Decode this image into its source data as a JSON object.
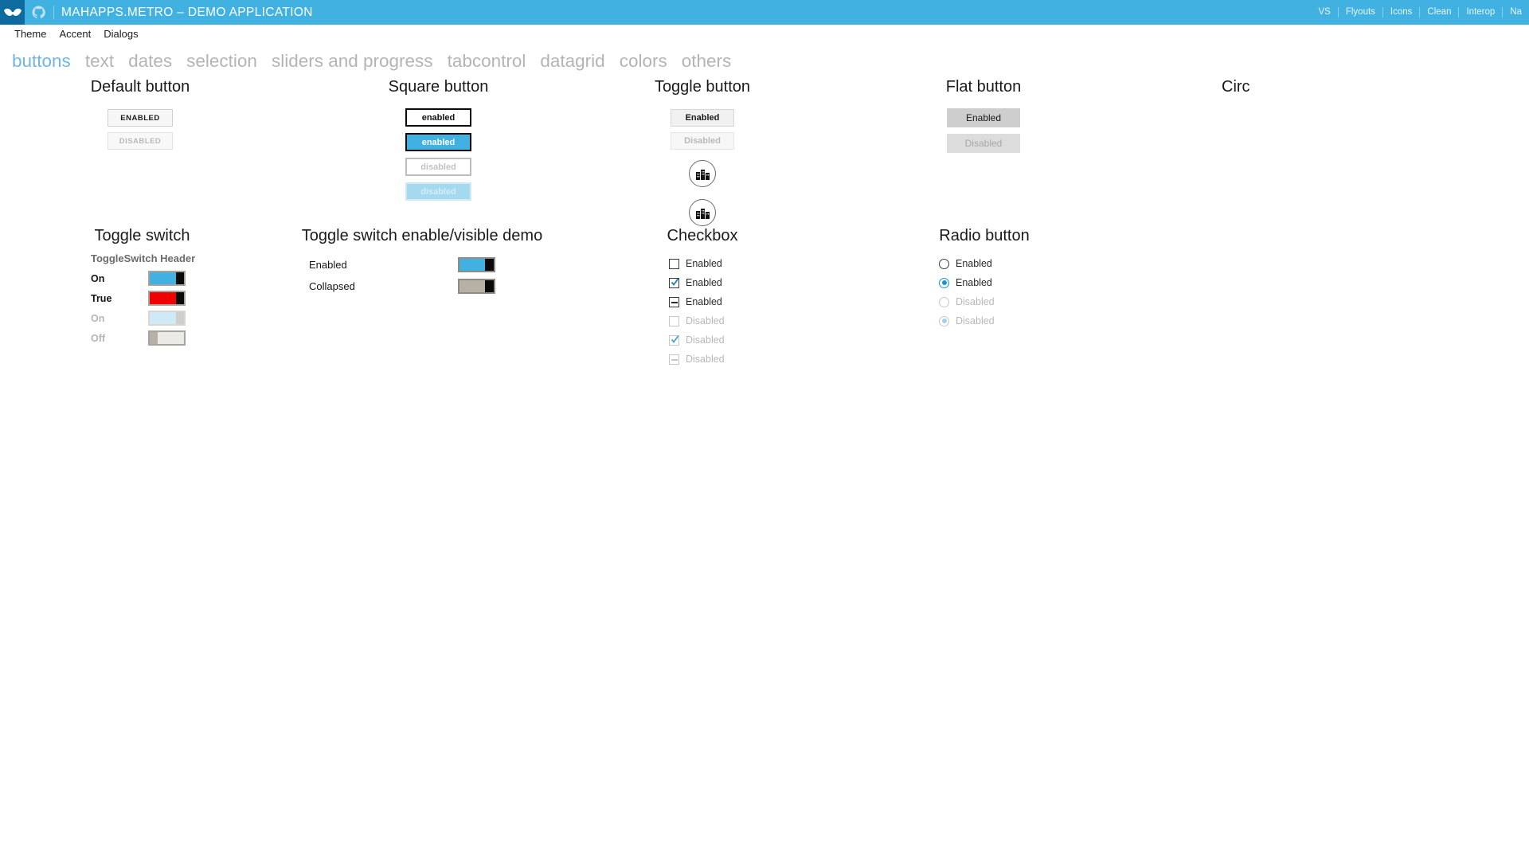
{
  "titlebar": {
    "title": "MAHAPPS.METRO – DEMO APPLICATION",
    "accent_color": "#41b1e1",
    "logo_color": "#0d6ba0",
    "links": [
      "VS",
      "Flyouts",
      "Icons",
      "Clean",
      "Interop",
      "Na"
    ]
  },
  "menubar": {
    "items": [
      "Theme",
      "Accent",
      "Dialogs"
    ]
  },
  "tabs": [
    {
      "label": "buttons",
      "active": true
    },
    {
      "label": "text",
      "active": false
    },
    {
      "label": "dates",
      "active": false
    },
    {
      "label": "selection",
      "active": false
    },
    {
      "label": "sliders and progress",
      "active": false
    },
    {
      "label": "tabcontrol",
      "active": false
    },
    {
      "label": "datagrid",
      "active": false
    },
    {
      "label": "colors",
      "active": false
    },
    {
      "label": "others",
      "active": false
    }
  ],
  "sections": {
    "default_button": {
      "heading": "Default button",
      "buttons": [
        {
          "label": "ENABLED",
          "state": "enabled"
        },
        {
          "label": "DISABLED",
          "state": "disabled"
        }
      ]
    },
    "square_button": {
      "heading": "Square button",
      "buttons": [
        {
          "label": "enabled",
          "style": "plain"
        },
        {
          "label": "enabled",
          "style": "accent"
        },
        {
          "label": "disabled",
          "style": "disabled"
        },
        {
          "label": "disabled",
          "style": "disabled-accent"
        }
      ]
    },
    "toggle_button": {
      "heading": "Toggle button",
      "buttons": [
        {
          "label": "Enabled",
          "state": "enabled"
        },
        {
          "label": "Disabled",
          "state": "disabled"
        }
      ],
      "circle_buttons": [
        {
          "icon": "city-buildings-icon",
          "state": "enabled"
        },
        {
          "icon": "city-buildings-icon",
          "state": "disabled"
        }
      ]
    },
    "flat_button": {
      "heading": "Flat button",
      "buttons": [
        {
          "label": "Enabled",
          "state": "enabled"
        },
        {
          "label": "Disabled",
          "state": "disabled"
        }
      ]
    },
    "circle_button": {
      "heading": "Circ"
    },
    "toggle_switch": {
      "heading": "Toggle switch",
      "subheading": "ToggleSwitch Header",
      "rows": [
        {
          "label": "On",
          "style": "on",
          "disabled": false
        },
        {
          "label": "True",
          "style": "red",
          "disabled": false
        },
        {
          "label": "On",
          "style": "disabled-on",
          "disabled": true
        },
        {
          "label": "Off",
          "style": "off",
          "disabled": true
        }
      ]
    },
    "toggle_switch_demo": {
      "heading": "Toggle switch enable/visible demo",
      "rows": [
        {
          "label": "Enabled",
          "style": "on"
        },
        {
          "label": "Collapsed",
          "style": "grey"
        }
      ]
    },
    "checkbox": {
      "heading": "Checkbox",
      "items": [
        {
          "label": "Enabled",
          "state": "unchecked",
          "disabled": false
        },
        {
          "label": "Enabled",
          "state": "checked",
          "disabled": false
        },
        {
          "label": "Enabled",
          "state": "indeterminate",
          "disabled": false
        },
        {
          "label": "Disabled",
          "state": "unchecked",
          "disabled": true
        },
        {
          "label": "Disabled",
          "state": "checked",
          "disabled": true
        },
        {
          "label": "Disabled",
          "state": "indeterminate",
          "disabled": true
        }
      ]
    },
    "radio_button": {
      "heading": "Radio button",
      "items": [
        {
          "label": "Enabled",
          "selected": false,
          "disabled": false
        },
        {
          "label": "Enabled",
          "selected": true,
          "disabled": false
        },
        {
          "label": "Disabled",
          "selected": false,
          "disabled": true
        },
        {
          "label": "Disabled",
          "selected": true,
          "disabled": true
        }
      ]
    }
  }
}
